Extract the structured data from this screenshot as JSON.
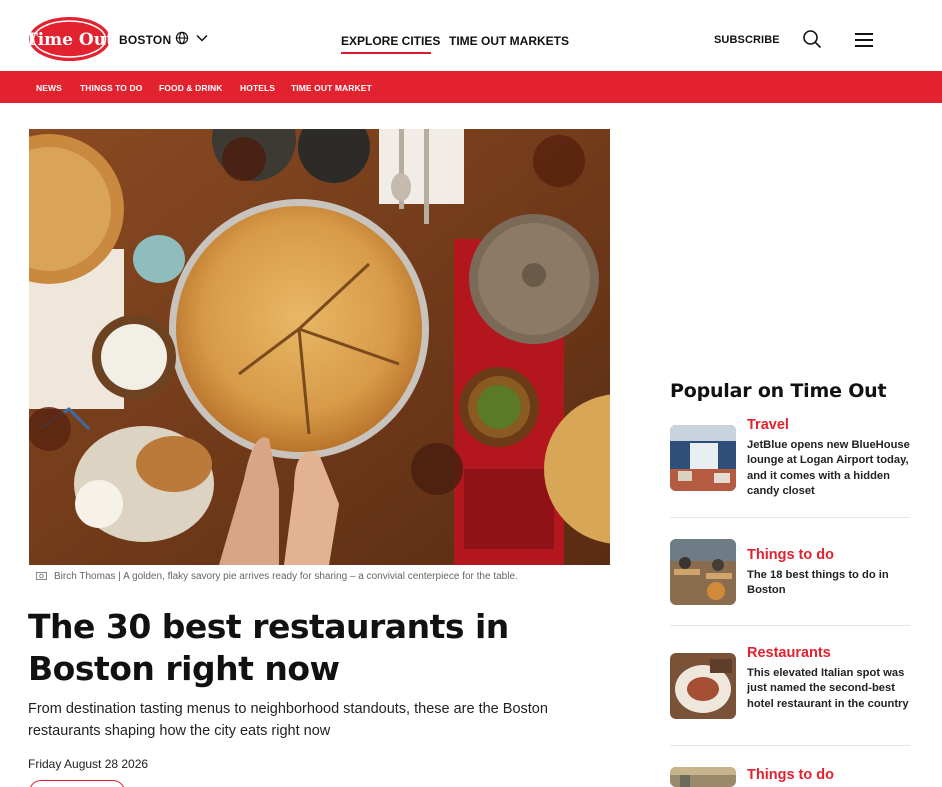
{
  "header": {
    "logo_text": "Time Out",
    "city": "BOSTON",
    "globe_icon": "globe-icon",
    "nav": [
      "EXPLORE CITIES",
      "TIME OUT MARKETS"
    ],
    "subscribe": "SUBSCRIBE",
    "brand_color": "#e2222f"
  },
  "subnav": [
    "NEWS",
    "THINGS TO DO",
    "FOOD & DRINK",
    "HOTELS",
    "TIME OUT MARKET"
  ],
  "article": {
    "image_credit": "Birch Thomas",
    "image_caption": "A golden, flaky savory pie arrives ready for sharing – a convivial centerpiece for the table.",
    "title": "The 30 best restaurants in Boston right now",
    "dek": "From destination tasting menus to neighborhood standouts, these are the Boston restaurants shaping how the city eats right now",
    "date": "Friday August 28 2026"
  },
  "sidebar": {
    "title": "Popular on Time Out",
    "cards": [
      {
        "category": "Travel",
        "title": "JetBlue opens new BlueHouse lounge at Logan Airport today, and it comes with a hidden candy closet"
      },
      {
        "category": "Things to do",
        "title": "The 18 best things to do in Boston"
      },
      {
        "category": "Restaurants",
        "title": "This elevated Italian spot was just named the second-best hotel restaurant in the country"
      },
      {
        "category": "Things to do",
        "title": ""
      }
    ]
  }
}
